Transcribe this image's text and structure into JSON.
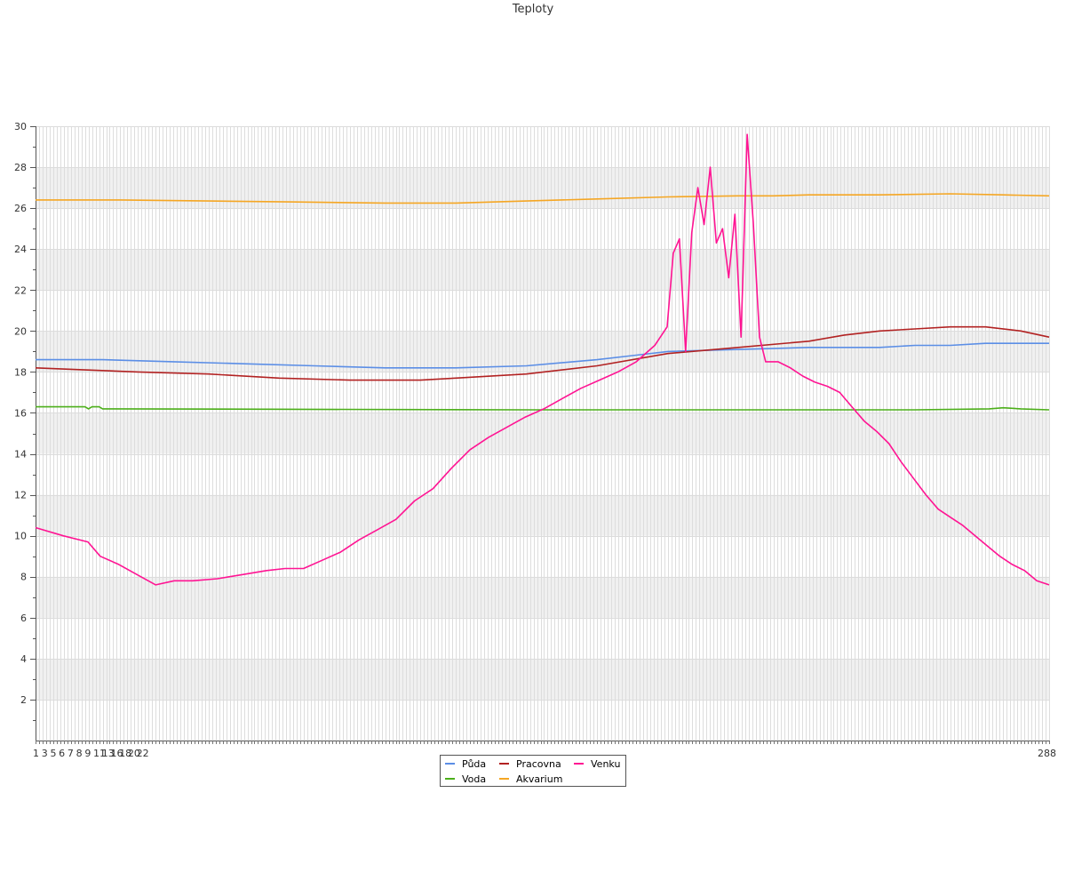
{
  "chart_data": {
    "type": "line",
    "title": "Teploty",
    "xlabel": "",
    "ylabel": "",
    "ylim": [
      0,
      30
    ],
    "yticks": [
      2,
      4,
      6,
      8,
      10,
      12,
      14,
      16,
      18,
      20,
      22,
      24,
      26,
      28,
      30
    ],
    "x_count": 288,
    "x_first_labels": [
      "1",
      "3",
      "5",
      "6",
      "7",
      "8",
      "9",
      "11",
      "13",
      "16",
      "18",
      "20",
      "22"
    ],
    "x_last_label": "288",
    "grid": true,
    "legend_position": "bottom",
    "series": [
      {
        "name": "Půda",
        "color": "#5b8ee6",
        "points": [
          [
            1,
            18.6
          ],
          [
            20,
            18.6
          ],
          [
            40,
            18.5
          ],
          [
            60,
            18.4
          ],
          [
            80,
            18.3
          ],
          [
            100,
            18.2
          ],
          [
            120,
            18.2
          ],
          [
            140,
            18.3
          ],
          [
            160,
            18.6
          ],
          [
            170,
            18.8
          ],
          [
            180,
            19.0
          ],
          [
            200,
            19.1
          ],
          [
            220,
            19.2
          ],
          [
            240,
            19.2
          ],
          [
            250,
            19.3
          ],
          [
            260,
            19.3
          ],
          [
            270,
            19.4
          ],
          [
            288,
            19.4
          ]
        ]
      },
      {
        "name": "Voda",
        "color": "#4caf1a",
        "points": [
          [
            1,
            16.3
          ],
          [
            15,
            16.3
          ],
          [
            16,
            16.2
          ],
          [
            17,
            16.3
          ],
          [
            19,
            16.3
          ],
          [
            20,
            16.2
          ],
          [
            140,
            16.15
          ],
          [
            145,
            16.15
          ],
          [
            200,
            16.15
          ],
          [
            250,
            16.15
          ],
          [
            271,
            16.2
          ],
          [
            275,
            16.25
          ],
          [
            280,
            16.2
          ],
          [
            288,
            16.15
          ]
        ]
      },
      {
        "name": "Pracovna",
        "color": "#b22222",
        "points": [
          [
            1,
            18.2
          ],
          [
            15,
            18.1
          ],
          [
            30,
            18.0
          ],
          [
            50,
            17.9
          ],
          [
            70,
            17.7
          ],
          [
            90,
            17.6
          ],
          [
            110,
            17.6
          ],
          [
            120,
            17.7
          ],
          [
            140,
            17.9
          ],
          [
            160,
            18.3
          ],
          [
            180,
            18.9
          ],
          [
            200,
            19.2
          ],
          [
            220,
            19.5
          ],
          [
            230,
            19.8
          ],
          [
            240,
            20.0
          ],
          [
            250,
            20.1
          ],
          [
            260,
            20.2
          ],
          [
            270,
            20.2
          ],
          [
            280,
            20.0
          ],
          [
            288,
            19.7
          ]
        ]
      },
      {
        "name": "Akvarium",
        "color": "#f5a623",
        "points": [
          [
            1,
            26.4
          ],
          [
            25,
            26.4
          ],
          [
            50,
            26.35
          ],
          [
            75,
            26.3
          ],
          [
            100,
            26.25
          ],
          [
            120,
            26.25
          ],
          [
            140,
            26.35
          ],
          [
            160,
            26.45
          ],
          [
            180,
            26.55
          ],
          [
            200,
            26.6
          ],
          [
            210,
            26.6
          ],
          [
            220,
            26.65
          ],
          [
            240,
            26.65
          ],
          [
            260,
            26.7
          ],
          [
            275,
            26.65
          ],
          [
            288,
            26.6
          ]
        ]
      },
      {
        "name": "Venku",
        "color": "#ff1493",
        "points": [
          [
            1,
            10.4
          ],
          [
            10,
            10.0
          ],
          [
            18,
            9.7
          ],
          [
            22,
            9.0
          ],
          [
            28,
            8.6
          ],
          [
            34,
            8.1
          ],
          [
            40,
            7.6
          ],
          [
            46,
            7.8
          ],
          [
            52,
            7.8
          ],
          [
            60,
            7.9
          ],
          [
            68,
            8.1
          ],
          [
            76,
            8.3
          ],
          [
            82,
            8.4
          ],
          [
            88,
            8.4
          ],
          [
            94,
            8.8
          ],
          [
            100,
            9.2
          ],
          [
            106,
            9.8
          ],
          [
            112,
            10.3
          ],
          [
            118,
            10.8
          ],
          [
            124,
            11.7
          ],
          [
            130,
            12.3
          ],
          [
            136,
            13.3
          ],
          [
            142,
            14.2
          ],
          [
            148,
            14.8
          ],
          [
            154,
            15.3
          ],
          [
            160,
            15.8
          ],
          [
            166,
            16.2
          ],
          [
            172,
            16.7
          ],
          [
            178,
            17.2
          ],
          [
            184,
            17.6
          ],
          [
            190,
            18.0
          ],
          [
            196,
            18.5
          ],
          [
            202,
            19.3
          ],
          [
            206,
            20.2
          ],
          [
            208,
            23.8
          ],
          [
            210,
            24.5
          ],
          [
            212,
            19.0
          ],
          [
            214,
            24.8
          ],
          [
            216,
            27.0
          ],
          [
            218,
            25.2
          ],
          [
            220,
            28.0
          ],
          [
            222,
            24.3
          ],
          [
            224,
            25.0
          ],
          [
            226,
            22.6
          ],
          [
            228,
            25.7
          ],
          [
            230,
            19.7
          ],
          [
            232,
            29.6
          ],
          [
            234,
            25.2
          ],
          [
            236,
            19.7
          ],
          [
            238,
            18.5
          ],
          [
            242,
            18.5
          ],
          [
            246,
            18.2
          ],
          [
            250,
            17.8
          ],
          [
            254,
            17.5
          ],
          [
            258,
            17.3
          ],
          [
            262,
            17.0
          ],
          [
            266,
            16.3
          ],
          [
            270,
            15.6
          ],
          [
            274,
            15.1
          ],
          [
            278,
            14.5
          ],
          [
            282,
            13.6
          ],
          [
            286,
            12.8
          ],
          [
            290,
            12.0
          ],
          [
            294,
            11.3
          ],
          [
            298,
            10.9
          ],
          [
            302,
            10.5
          ],
          [
            306,
            10.0
          ],
          [
            310,
            9.5
          ],
          [
            314,
            9.0
          ],
          [
            318,
            8.6
          ],
          [
            322,
            8.3
          ],
          [
            326,
            7.8
          ],
          [
            330,
            7.6
          ]
        ]
      }
    ]
  }
}
